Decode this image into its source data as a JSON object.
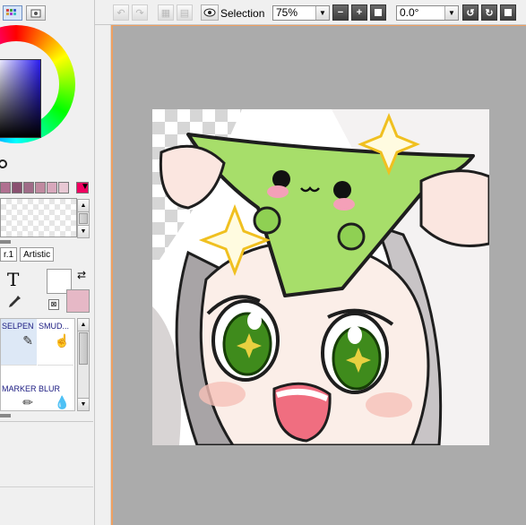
{
  "toolbar": {
    "selection_label": "Selection",
    "zoom_value": "75%",
    "zoom_out_label": "−",
    "zoom_in_label": "+",
    "zoom_reset_label": "",
    "rotation_value": "0.0°"
  },
  "left_panel": {
    "swatch_colors": [
      "#b07090",
      "#8a5070",
      "#a06c88",
      "#c08aa0",
      "#d8a8bc",
      "#e8c8d4",
      "#f00060"
    ],
    "tabs": [
      "r.1",
      "Artistic"
    ],
    "main_color": "#ffffff",
    "sub_color": "#e6b8c6",
    "tools": {
      "text_icon": "T",
      "dropper_icon": "eyedropper-icon"
    },
    "brushes": [
      {
        "name": "SELPEN",
        "icon": "selpen-icon"
      },
      {
        "name": "SMUD...",
        "icon": "smudge-icon"
      },
      {
        "name": "MARKER",
        "icon": "marker-icon"
      },
      {
        "name": "BLUR",
        "icon": "blur-icon"
      }
    ]
  },
  "canvas": {
    "background": "#ababab",
    "artwork": "chibi character holding green face mask with sparkles"
  }
}
